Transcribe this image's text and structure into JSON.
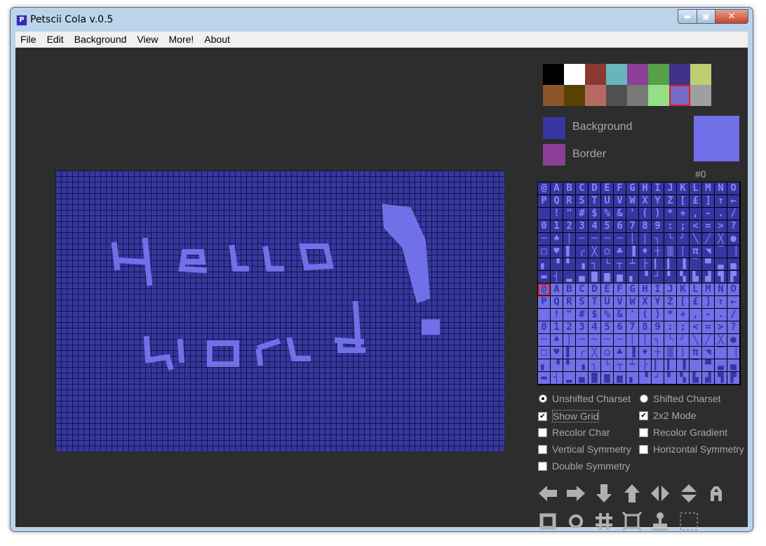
{
  "window": {
    "title": "Petscii Cola v.0.5",
    "app_icon_letter": "P",
    "min": "▬",
    "max": "▣",
    "close": "✕"
  },
  "menu": [
    "File",
    "Edit",
    "Background",
    "View",
    "More!",
    "About"
  ],
  "palette": {
    "colors": [
      "#000000",
      "#ffffff",
      "#883932",
      "#67b6bd",
      "#8b3f96",
      "#55a049",
      "#40318d",
      "#bfce72",
      "#8b5429",
      "#574200",
      "#b86962",
      "#505050",
      "#787878",
      "#94e089",
      "#7869c4",
      "#9f9f9f"
    ],
    "selected_index": 14
  },
  "background": {
    "label": "Background",
    "color": "#3636a2"
  },
  "border": {
    "label": "Border",
    "color": "#8b3f96"
  },
  "preview": {
    "color": "#7070e8"
  },
  "char_number": "#0",
  "charset": {
    "rows": [
      [
        "@",
        "A",
        "B",
        "C",
        "D",
        "E",
        "F",
        "G",
        "H",
        "I",
        "J",
        "K",
        "L",
        "M",
        "N",
        "O"
      ],
      [
        "P",
        "Q",
        "R",
        "S",
        "T",
        "U",
        "V",
        "W",
        "X",
        "Y",
        "Z",
        "[",
        "£",
        "]",
        "↑",
        "←"
      ],
      [
        " ",
        "!",
        "\"",
        "#",
        "$",
        "%",
        "&",
        "'",
        "(",
        ")",
        "*",
        "+",
        ",",
        "-",
        ".",
        "/"
      ],
      [
        "0",
        "1",
        "2",
        "3",
        "4",
        "5",
        "6",
        "7",
        "8",
        "9",
        ":",
        ";",
        "<",
        "=",
        ">",
        "?"
      ],
      [
        "─",
        "♠",
        "│",
        "─",
        "─",
        "─",
        "─",
        "│",
        "│",
        "╮",
        "╰",
        "╯",
        "╲",
        "╱",
        "╳",
        "●"
      ],
      [
        "□",
        "♥",
        "▌",
        "╭",
        "╳",
        "○",
        "♣",
        "▐",
        "♦",
        "┼",
        "▒",
        "│",
        "π",
        "◥",
        "▔",
        "▕"
      ],
      [
        "▖",
        "▝",
        "▘",
        "▗",
        "┐",
        "└",
        "┬",
        "┴",
        "├",
        "▎",
        "▍",
        "▐",
        "▔",
        "▀",
        "▃",
        "▄"
      ],
      [
        "▬",
        "┤",
        "▂",
        "▄",
        "▇",
        "▆",
        "▅",
        "▖",
        "▝",
        "┘",
        "▘",
        "▚",
        "▙",
        "▟",
        "▜",
        "▛"
      ],
      [
        "@",
        "A",
        "B",
        "C",
        "D",
        "E",
        "F",
        "G",
        "H",
        "I",
        "J",
        "K",
        "L",
        "M",
        "N",
        "O"
      ],
      [
        "P",
        "Q",
        "R",
        "S",
        "T",
        "U",
        "V",
        "W",
        "X",
        "Y",
        "Z",
        "[",
        "£",
        "]",
        "↑",
        "←"
      ],
      [
        " ",
        "!",
        "\"",
        "#",
        "$",
        "%",
        "&",
        "'",
        "(",
        ")",
        "*",
        "+",
        ",",
        "-",
        ".",
        "/"
      ],
      [
        "0",
        "1",
        "2",
        "3",
        "4",
        "5",
        "6",
        "7",
        "8",
        "9",
        ":",
        ";",
        "<",
        "=",
        ">",
        "?"
      ],
      [
        "─",
        "♠",
        "│",
        "─",
        "─",
        "─",
        "─",
        "│",
        "│",
        "╮",
        "╰",
        "╯",
        "╲",
        "╱",
        "╳",
        "●"
      ],
      [
        "□",
        "♥",
        "▌",
        "╭",
        "╳",
        "○",
        "♣",
        "▐",
        "♦",
        "┼",
        "▒",
        "│",
        "π",
        "◥",
        "▔",
        "▕"
      ],
      [
        "▖",
        "▝",
        "▘",
        "▗",
        "┐",
        "└",
        "┬",
        "┴",
        "├",
        "▎",
        "▍",
        "▐",
        "▔",
        "▀",
        "▃",
        "▄"
      ],
      [
        "▬",
        "┤",
        "▂",
        "▄",
        "▇",
        "▆",
        "▅",
        "▖",
        "▝",
        "┘",
        "▘",
        "▚",
        "▙",
        "▟",
        "▜",
        "▛"
      ]
    ],
    "selected_row": 8,
    "selected_col": 0
  },
  "options": {
    "unshifted": {
      "label": "Unshifted Charset",
      "checked": true
    },
    "shifted": {
      "label": "Shifted Charset",
      "checked": false
    },
    "show_grid": {
      "label": "Show Grid",
      "checked": true
    },
    "mode_2x2": {
      "label": "2x2 Mode",
      "checked": true
    },
    "recolor_char": {
      "label": "Recolor Char",
      "checked": false
    },
    "recolor_gradient": {
      "label": "Recolor Gradient",
      "checked": false
    },
    "vertical_symmetry": {
      "label": "Vertical Symmetry",
      "checked": false
    },
    "horizontal_symmetry": {
      "label": "Horizontal Symmetry",
      "checked": false
    },
    "double_symmetry": {
      "label": "Double Symmetry",
      "checked": false
    }
  },
  "tools": {
    "row1": [
      "arrow-left-icon",
      "arrow-right-icon",
      "arrow-down-icon",
      "arrow-up-icon",
      "flip-horizontal-icon",
      "flip-vertical-icon",
      "character-icon"
    ],
    "row2": [
      "rectangle-icon",
      "circle-icon",
      "grid-icon",
      "frame-icon",
      "stamp-icon",
      "selection-icon"
    ]
  },
  "colors": {
    "ink": "#7070e8",
    "canvas_bg": "#3636a2",
    "tool_gray": "#b0b0b0"
  },
  "canvas_text": [
    "Hello",
    "world"
  ]
}
